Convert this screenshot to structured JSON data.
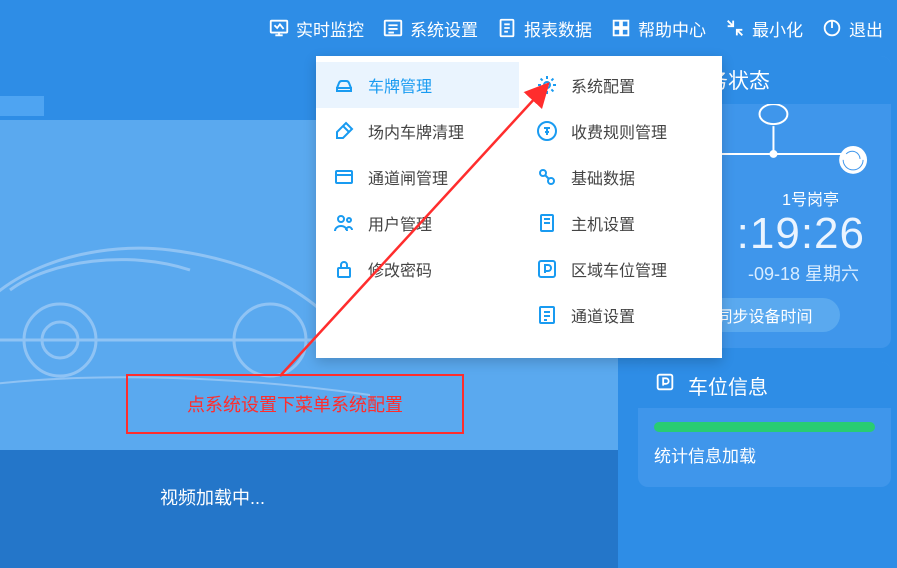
{
  "topnav": {
    "monitor": "实时监控",
    "settings": "系统设置",
    "reports": "报表数据",
    "help": "帮助中心",
    "minimize": "最小化",
    "exit": "退出"
  },
  "menu": {
    "left": [
      {
        "key": "plate-mgmt",
        "label": "车牌管理",
        "active": true
      },
      {
        "key": "plate-clean",
        "label": "场内车牌清理"
      },
      {
        "key": "gate-mgmt",
        "label": "通道闸管理"
      },
      {
        "key": "user-mgmt",
        "label": "用户管理"
      },
      {
        "key": "change-pwd",
        "label": "修改密码"
      }
    ],
    "right": [
      {
        "key": "sys-config",
        "label": "系统配置"
      },
      {
        "key": "fee-rules",
        "label": "收费规则管理"
      },
      {
        "key": "base-data",
        "label": "基础数据"
      },
      {
        "key": "host-set",
        "label": "主机设置"
      },
      {
        "key": "zone-park",
        "label": "区域车位管理"
      },
      {
        "key": "channel-set",
        "label": "通道设置"
      }
    ]
  },
  "callout": {
    "text": "点系统设置下菜单系统配置"
  },
  "video": {
    "loading": "视频加载中..."
  },
  "status": {
    "title": "服务状态",
    "booth": "1号岗亭",
    "time": ":19:26",
    "date": "-09-18 星期六",
    "sync_btn": "同步设备时间"
  },
  "parking": {
    "title": "车位信息",
    "stat_text": "统计信息加载",
    "progress_pct": 100
  }
}
